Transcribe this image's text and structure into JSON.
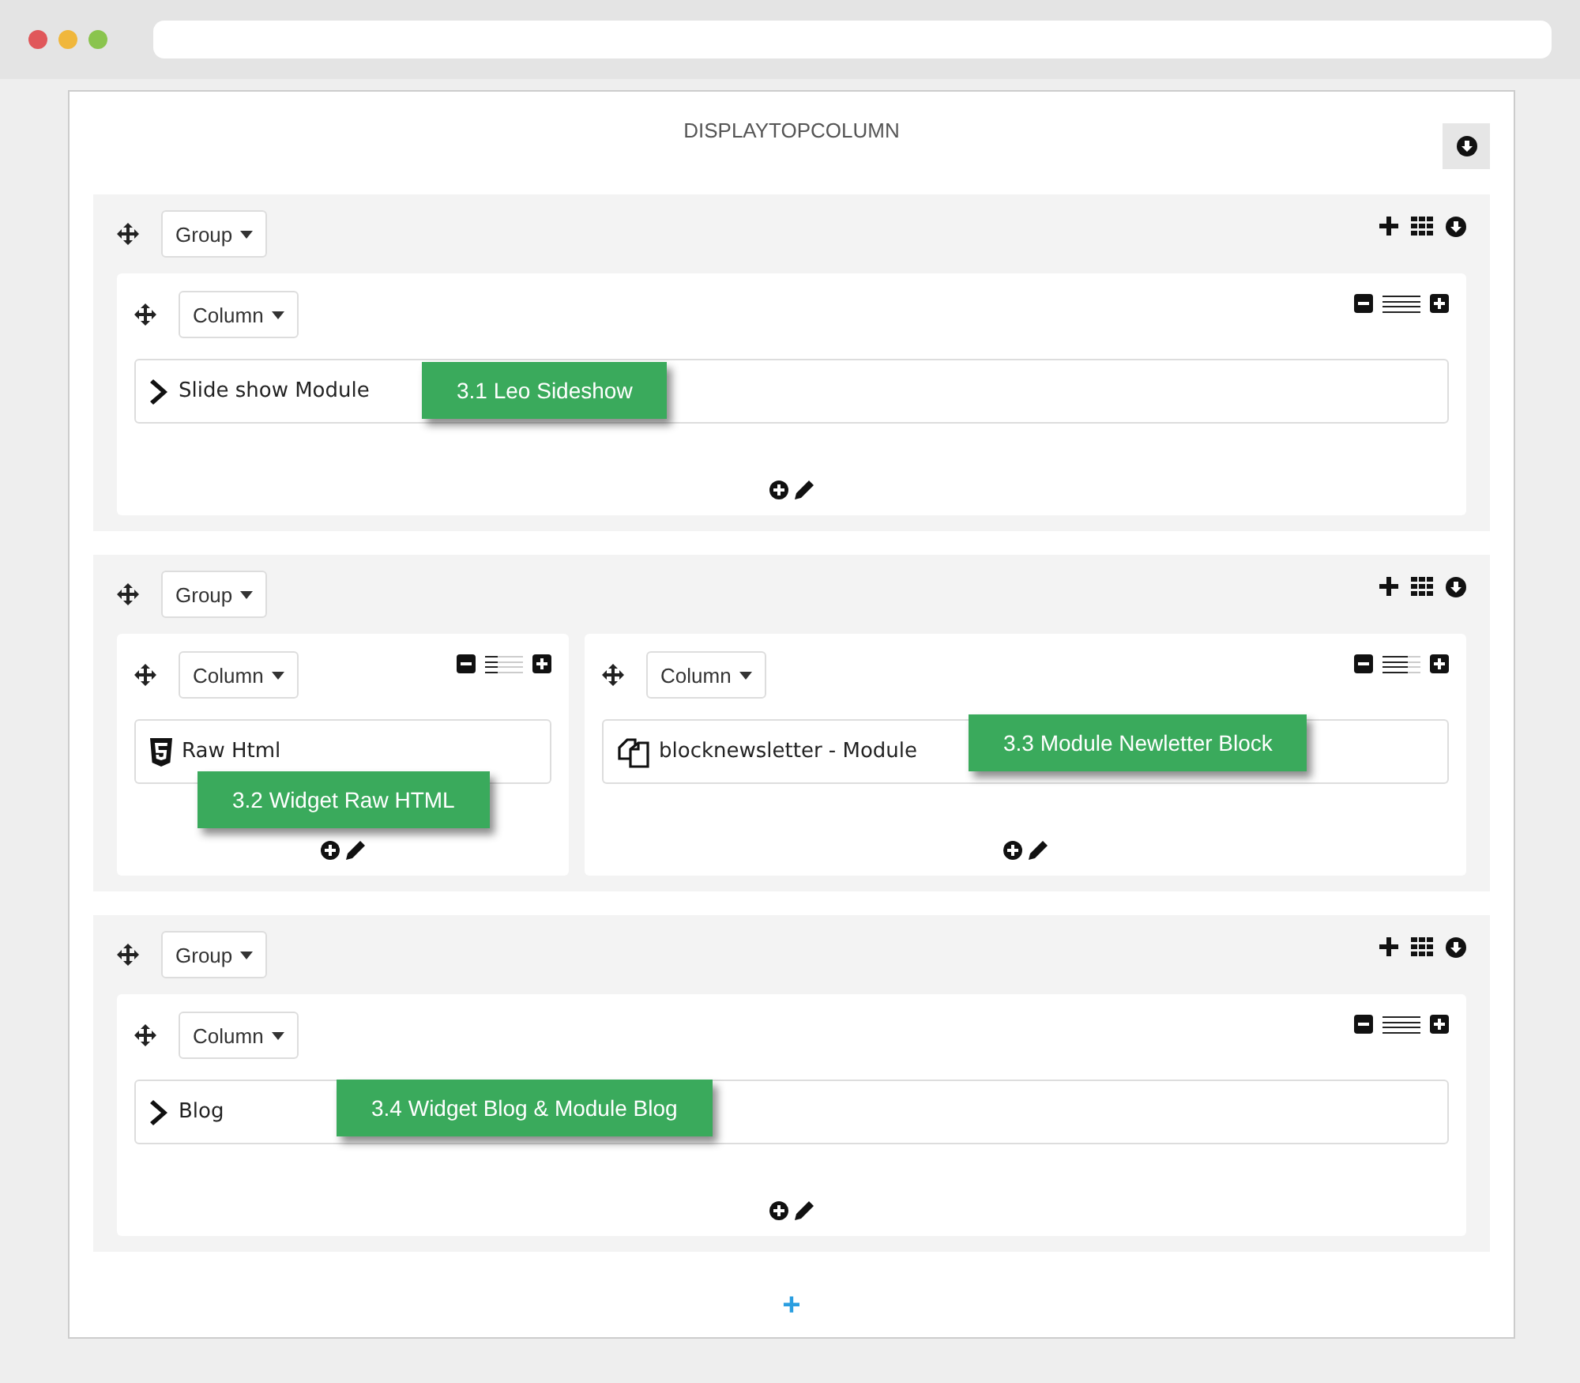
{
  "section": {
    "title": "DISPLAYTOPCOLUMN",
    "add_label": "+"
  },
  "groups": [
    {
      "label": "Group",
      "columns": [
        {
          "label": "Column",
          "level": 1,
          "modules": [
            {
              "kind": "chevron",
              "label": "Slide show Module",
              "callout": "3.1 Leo Sideshow"
            }
          ]
        }
      ]
    },
    {
      "label": "Group",
      "columns": [
        {
          "label": "Column",
          "level": 0.33,
          "modules": [
            {
              "kind": "html5",
              "label": "Raw Html",
              "callout": "3.2 Widget Raw HTML"
            }
          ]
        },
        {
          "label": "Column",
          "level": 0.67,
          "modules": [
            {
              "kind": "copy",
              "label": "blocknewsletter - Module",
              "callout": "3.3 Module Newletter Block"
            }
          ]
        }
      ]
    },
    {
      "label": "Group",
      "columns": [
        {
          "label": "Column",
          "level": 1,
          "modules": [
            {
              "kind": "chevron",
              "label": "Blog",
              "callout": "3.4 Widget Blog & Module Blog"
            }
          ]
        }
      ]
    }
  ]
}
